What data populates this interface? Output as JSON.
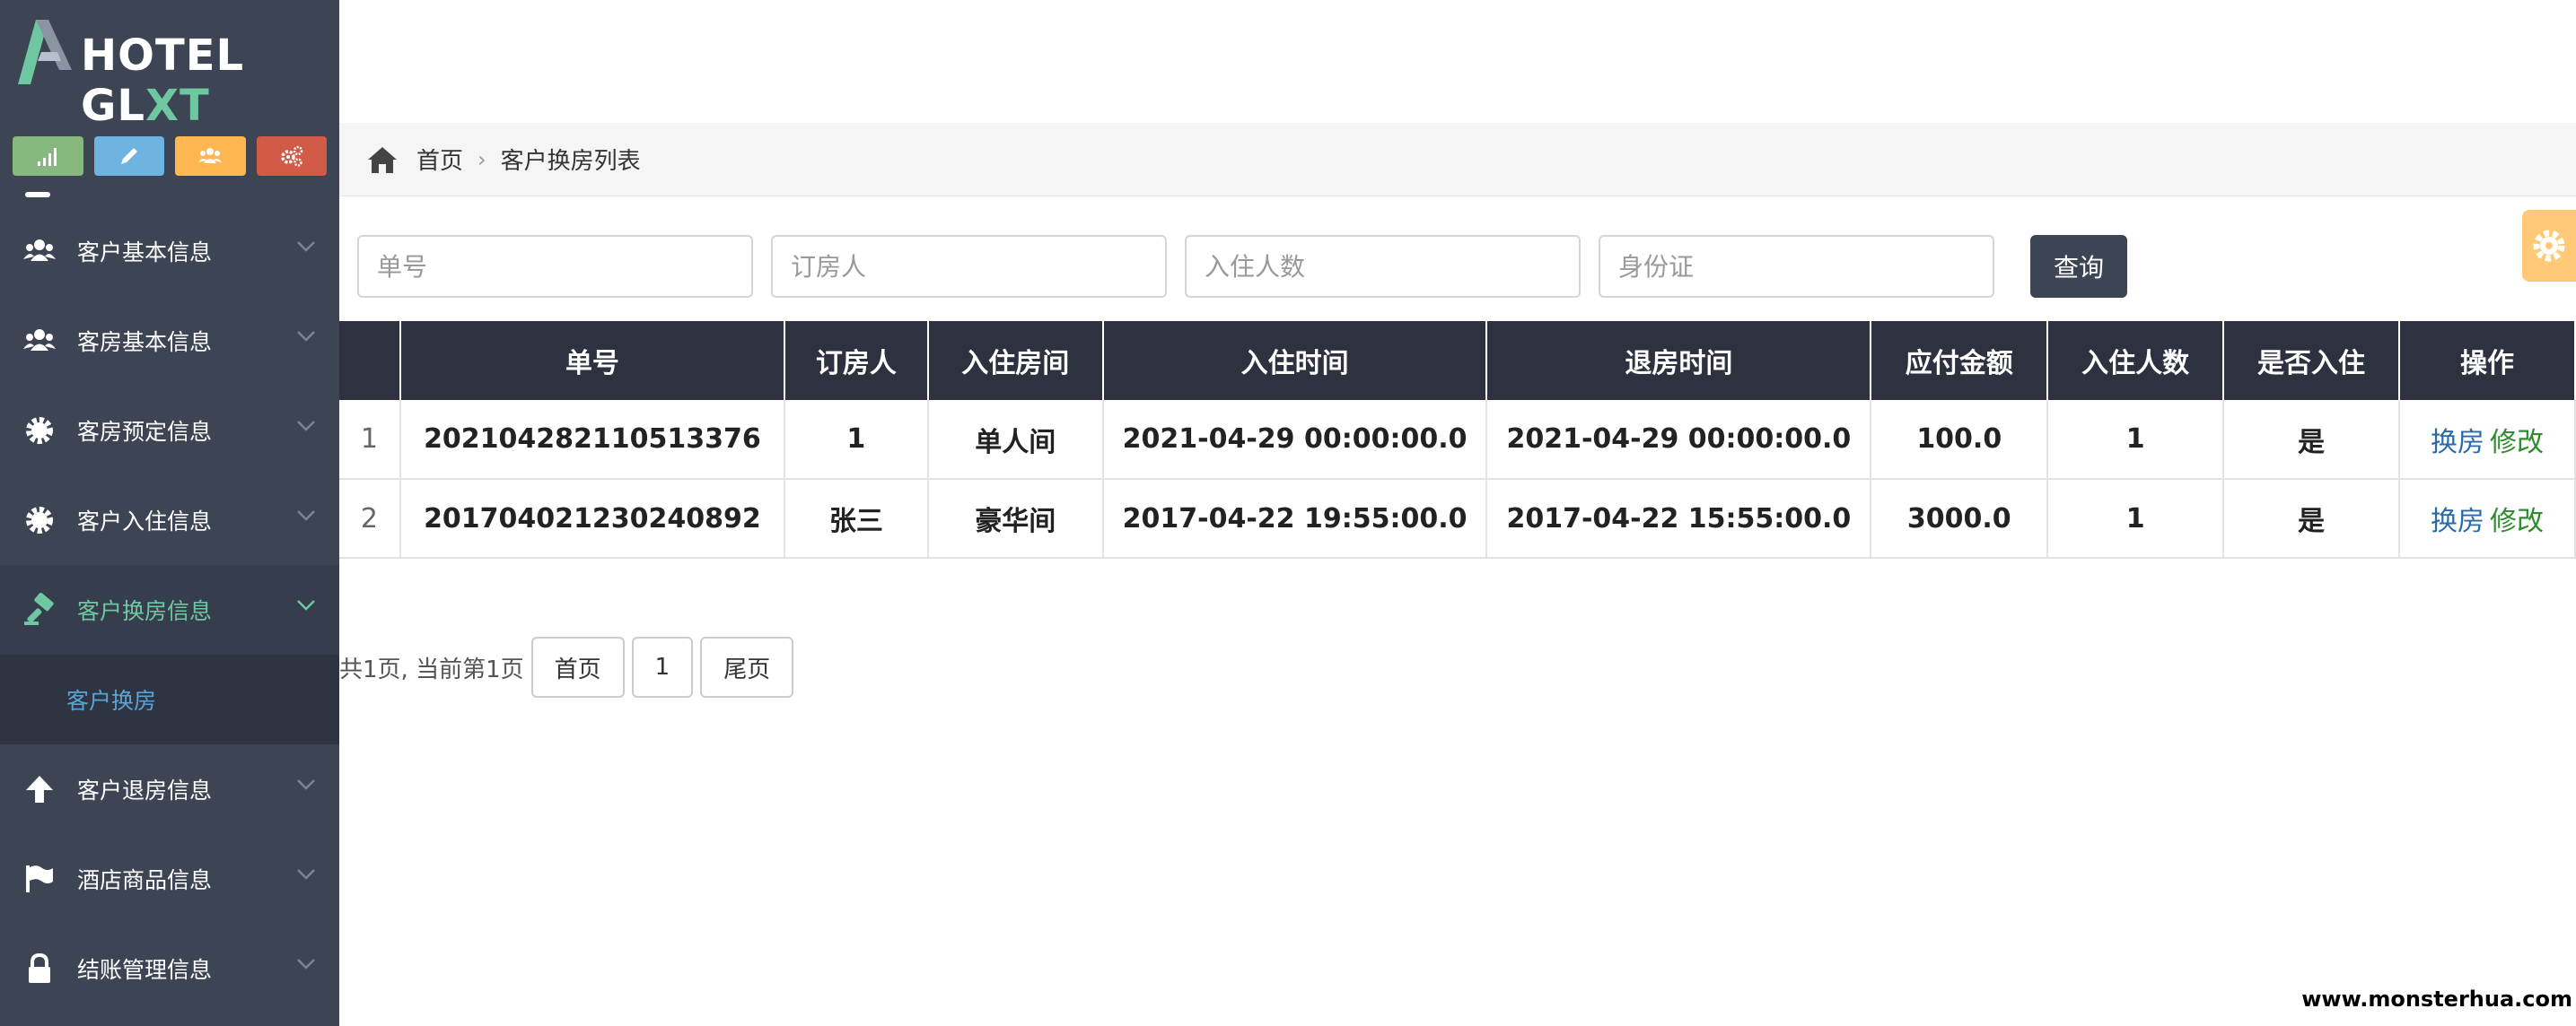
{
  "brand": {
    "main": "HOTEL GL",
    "accent": "XT"
  },
  "shortcuts": [
    {
      "icon": "signal-icon",
      "color": "#87b87f"
    },
    {
      "icon": "pencil-icon",
      "color": "#6fb3e0"
    },
    {
      "icon": "users-icon",
      "color": "#ffb752"
    },
    {
      "icon": "gears-icon",
      "color": "#d15b47"
    }
  ],
  "sidebar": {
    "items": [
      {
        "label": "客户基本信息",
        "icon": "users-icon"
      },
      {
        "label": "客房基本信息",
        "icon": "users-icon"
      },
      {
        "label": "客房预定信息",
        "icon": "cog-icon"
      },
      {
        "label": "客户入住信息",
        "icon": "cog-icon"
      },
      {
        "label": "客户换房信息",
        "icon": "gavel-icon",
        "active": true
      },
      {
        "label": "客户退房信息",
        "icon": "arrow-up-icon"
      },
      {
        "label": "酒店商品信息",
        "icon": "flag-icon"
      },
      {
        "label": "结账管理信息",
        "icon": "lock-icon"
      }
    ],
    "submenu": {
      "label": "客户换房"
    }
  },
  "breadcrumb": {
    "home": "首页",
    "current": "客户换房列表"
  },
  "search": {
    "order_no_placeholder": "单号",
    "booker_placeholder": "订房人",
    "guests_placeholder": "入住人数",
    "id_card_placeholder": "身份证",
    "query_label": "查询"
  },
  "table": {
    "headers": [
      "",
      "单号",
      "订房人",
      "入住房间",
      "入住时间",
      "退房时间",
      "应付金额",
      "入住人数",
      "是否入住",
      "操作"
    ],
    "rows": [
      {
        "idx": "1",
        "order_no": "202104282110513376",
        "booker": "1",
        "room": "单人间",
        "checkin": "2021-04-29 00:00:00.0",
        "checkout": "2021-04-29 00:00:00.0",
        "amount": "100.0",
        "guests": "1",
        "checked_in": "是"
      },
      {
        "idx": "2",
        "order_no": "201704021230240892",
        "booker": "张三",
        "room": "豪华间",
        "checkin": "2017-04-22 19:55:00.0",
        "checkout": "2017-04-22 15:55:00.0",
        "amount": "3000.0",
        "guests": "1",
        "checked_in": "是"
      }
    ],
    "op_swap": "换房",
    "op_edit": "修改"
  },
  "pager": {
    "info": "共1页, 当前第1页",
    "first": "首页",
    "page": "1",
    "last": "尾页"
  },
  "watermark": "www.monsterhua.com",
  "colors": {
    "sidebar_bg": "#3d4454",
    "accent_green": "#6fc7a2",
    "table_header": "#2e3240"
  }
}
